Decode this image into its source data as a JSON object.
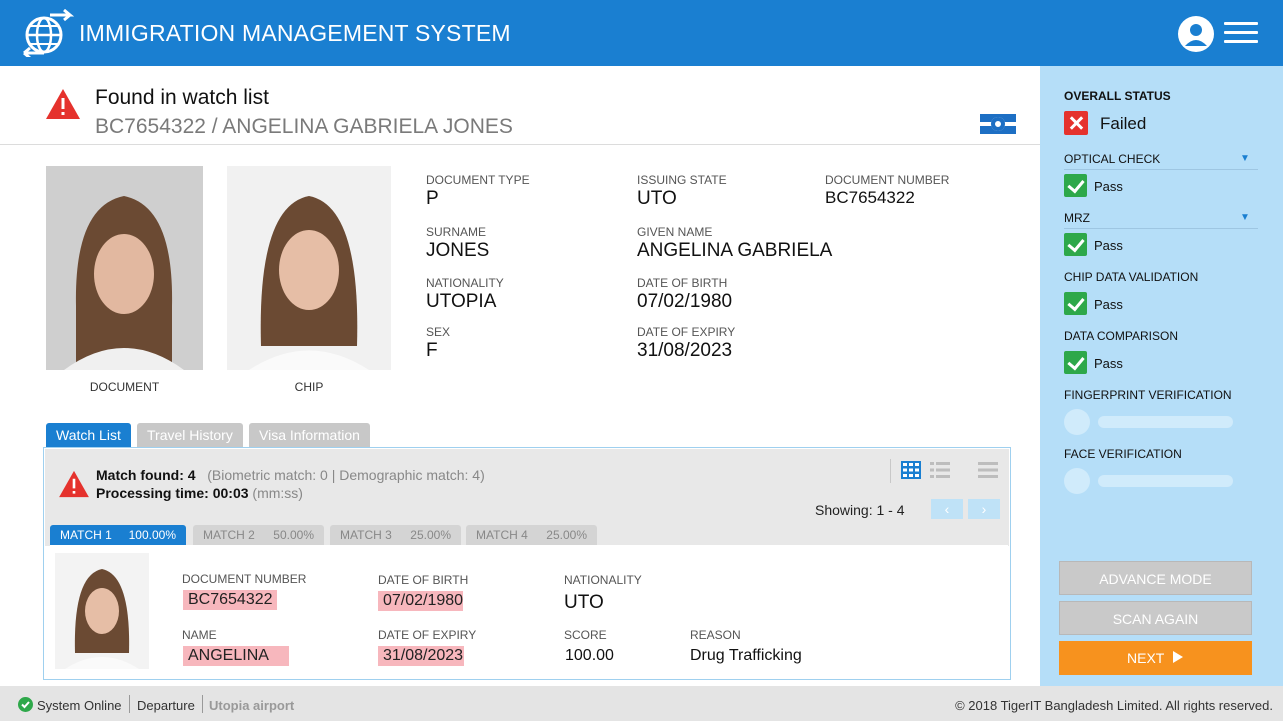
{
  "header": {
    "title": "IMMIGRATION MANAGEMENT SYSTEM",
    "logo_icon": "globe-arrows-icon",
    "user_icon": "user-icon",
    "menu_icon": "hamburger-icon"
  },
  "alert": {
    "title": "Found in watch list",
    "subtitle": "BC7654322 / ANGELINA GABRIELA JONES",
    "icon": "warning-icon",
    "flag_icon": "flag-icon"
  },
  "photos": {
    "document_label": "DOCUMENT",
    "chip_label": "CHIP"
  },
  "document": {
    "fields": [
      {
        "label": "DOCUMENT TYPE",
        "value": "P"
      },
      {
        "label": "ISSUING STATE",
        "value": "UTO"
      },
      {
        "label": "DOCUMENT NUMBER",
        "value": "BC7654322"
      },
      {
        "label": "SURNAME",
        "value": "JONES"
      },
      {
        "label": "GIVEN NAME",
        "value": "ANGELINA GABRIELA"
      },
      {
        "label": "NATIONALITY",
        "value": "UTOPIA"
      },
      {
        "label": "DATE OF BIRTH",
        "value": "07/02/1980"
      },
      {
        "label": "SEX",
        "value": "F"
      },
      {
        "label": "DATE OF EXPIRY",
        "value": "31/08/2023"
      }
    ]
  },
  "tabs": [
    {
      "label": "Watch List",
      "active": true
    },
    {
      "label": "Travel History",
      "active": false
    },
    {
      "label": "Visa Information",
      "active": false
    }
  ],
  "watchlist": {
    "match_found_label": "Match found:",
    "match_found_value": "4",
    "breakdown": "(Biometric match: 0   |   Demographic match: 4)",
    "processing_label": "Processing time:",
    "processing_value": "00:03",
    "processing_unit": "(mm:ss)",
    "showing": "Showing: 1 - 4",
    "prev": "‹",
    "next": "›",
    "matches": [
      {
        "name": "MATCH 1",
        "percent": "100.00%",
        "active": true
      },
      {
        "name": "MATCH 2",
        "percent": "50.00%",
        "active": false
      },
      {
        "name": "MATCH 3",
        "percent": "25.00%",
        "active": false
      },
      {
        "name": "MATCH 4",
        "percent": "25.00%",
        "active": false
      }
    ],
    "detail": {
      "doc_number_label": "DOCUMENT NUMBER",
      "doc_number": "BC7654322",
      "dob_label": "DATE OF BIRTH",
      "dob": "07/02/1980",
      "nationality_label": "NATIONALITY",
      "nationality": "UTO",
      "name_label": "NAME",
      "name": "ANGELINA",
      "expiry_label": "DATE OF EXPIRY",
      "expiry": "31/08/2023",
      "score_label": "SCORE",
      "score": "100.00",
      "reason_label": "REASON",
      "reason": "Drug Trafficking"
    }
  },
  "status": {
    "overall_label": "OVERALL STATUS",
    "overall_value": "Failed",
    "checks": [
      {
        "label": "OPTICAL CHECK",
        "result": "Pass",
        "expandable": true
      },
      {
        "label": "MRZ",
        "result": "Pass",
        "expandable": true
      },
      {
        "label": "CHIP DATA VALIDATION",
        "result": "Pass",
        "expandable": false
      },
      {
        "label": "DATA COMPARISON",
        "result": "Pass",
        "expandable": false
      }
    ],
    "pending": [
      {
        "label": "FINGERPRINT VERIFICATION"
      },
      {
        "label": "FACE VERIFICATION"
      }
    ],
    "caret": "▼"
  },
  "actions": {
    "advance": "ADVANCE MODE",
    "scan": "SCAN AGAIN",
    "next": "NEXT"
  },
  "footer": {
    "system": "System Online",
    "mode": "Departure",
    "location": "Utopia airport",
    "copyright": "© 2018 TigerIT Bangladesh Limited. All rights reserved."
  },
  "colors": {
    "primary": "#1a7fd1",
    "side_panel": "#b5def8",
    "pass": "#2ea84a",
    "fail": "#e5322d",
    "highlight": "#f7b7bd",
    "next_button": "#f7921e"
  }
}
